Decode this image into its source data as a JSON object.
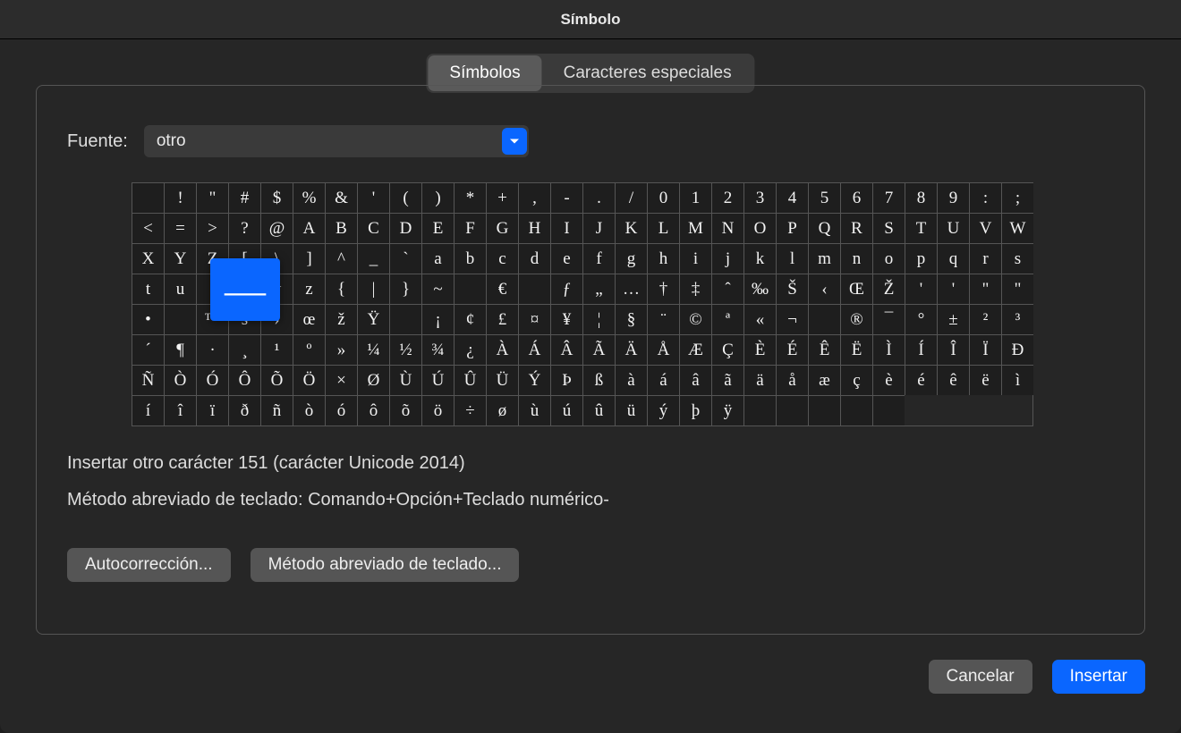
{
  "window": {
    "title": "Símbolo"
  },
  "tabs": {
    "symbols": "Símbolos",
    "special": "Caracteres especiales"
  },
  "font": {
    "label": "Fuente:",
    "value": "otro"
  },
  "grid": {
    "columns": 28,
    "selected_index": 87,
    "selected_char": "—",
    "chars": [
      "",
      "!",
      "\"",
      "#",
      "$",
      "%",
      "&",
      "'",
      "(",
      ")",
      "*",
      "+",
      ",",
      "-",
      ".",
      "/",
      "0",
      "1",
      "2",
      "3",
      "4",
      "5",
      "6",
      "7",
      "8",
      "9",
      ":",
      ";",
      "<",
      "=",
      ">",
      "?",
      "@",
      "A",
      "B",
      "C",
      "D",
      "E",
      "F",
      "G",
      "H",
      "I",
      "J",
      "K",
      "L",
      "M",
      "N",
      "O",
      "P",
      "Q",
      "R",
      "S",
      "T",
      "U",
      "V",
      "W",
      "X",
      "Y",
      "Z",
      "[",
      "\\",
      "]",
      "^",
      "_",
      "`",
      "a",
      "b",
      "c",
      "d",
      "e",
      "f",
      "g",
      "h",
      "i",
      "j",
      "k",
      "l",
      "m",
      "n",
      "o",
      "p",
      "q",
      "r",
      "s",
      "t",
      "u",
      "",
      "—",
      "y",
      "z",
      "{",
      "|",
      "}",
      "~",
      "",
      "€",
      "",
      "ƒ",
      "„",
      "…",
      "†",
      "‡",
      "ˆ",
      "‰",
      "Š",
      "‹",
      "Œ",
      "Ž",
      "'",
      "'",
      "\"",
      "\"",
      "•",
      "",
      "™",
      "š",
      "›",
      "œ",
      "ž",
      "Ÿ",
      "",
      "¡",
      "¢",
      "£",
      "¤",
      "¥",
      "¦",
      "§",
      "¨",
      "©",
      "ª",
      "«",
      "¬",
      "­",
      "®",
      "¯",
      "°",
      "±",
      "²",
      "³",
      "´",
      "¶",
      "·",
      "¸",
      "¹",
      "º",
      "»",
      "¼",
      "½",
      "¾",
      "¿",
      "À",
      "Á",
      "Â",
      "Ã",
      "Ä",
      "Å",
      "Æ",
      "Ç",
      "È",
      "É",
      "Ê",
      "Ë",
      "Ì",
      "Í",
      "Î",
      "Ï",
      "Ð",
      "Ñ",
      "Ò",
      "Ó",
      "Ô",
      "Õ",
      "Ö",
      "×",
      "Ø",
      "Ù",
      "Ú",
      "Û",
      "Ü",
      "Ý",
      "Þ",
      "ß",
      "à",
      "á",
      "â",
      "ã",
      "ä",
      "å",
      "æ",
      "ç",
      "è",
      "é",
      "ê",
      "ë",
      "ì",
      "í",
      "î",
      "ï",
      "ð",
      "ñ",
      "ò",
      "ó",
      "ô",
      "õ",
      "ö",
      "÷",
      "ø",
      "ù",
      "ú",
      "û",
      "ü",
      "ý",
      "þ",
      "ÿ",
      "",
      "",
      "",
      "",
      ""
    ]
  },
  "info": {
    "line1": "Insertar otro carácter 151 (carácter Unicode 2014)",
    "line2_label": "Método abreviado de teclado:  ",
    "line2_value": "Comando+Opción+Teclado numérico-"
  },
  "buttons": {
    "autocorrect": "Autocorrección...",
    "shortcut": "Método abreviado de teclado...",
    "cancel": "Cancelar",
    "insert": "Insertar"
  }
}
